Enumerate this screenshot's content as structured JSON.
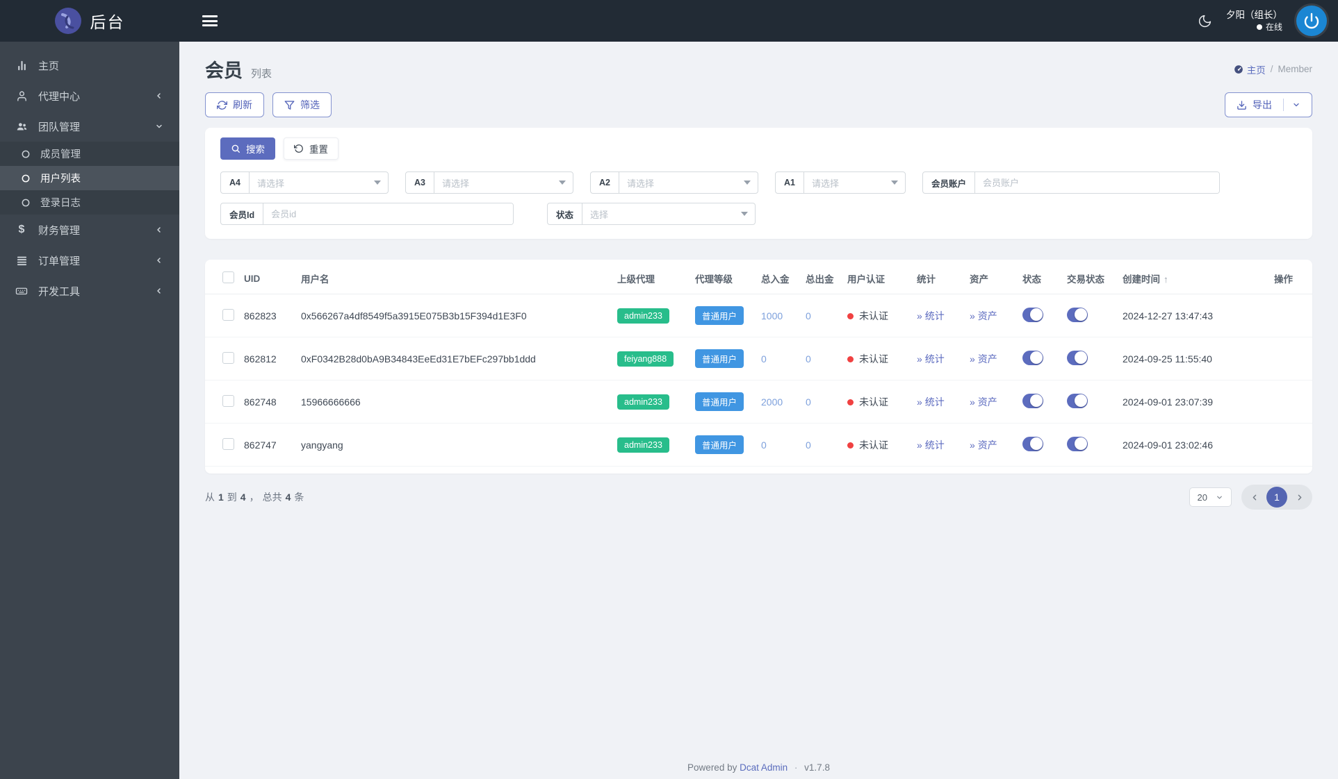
{
  "colors": {
    "primary": "#5c6cbe",
    "navbar_bg": "#222b35",
    "sidebar_bg": "#3c444d",
    "page_bg": "#f0f2f6",
    "badge_green": "#28bd8b",
    "badge_blue": "#4096e2",
    "danger_dot": "#f04141",
    "avatar_bg": "#1b86d3"
  },
  "navbar": {
    "logo_text": "后台",
    "user_name": "夕阳（组长）",
    "user_status": "在线"
  },
  "sidebar": {
    "items": [
      {
        "label": "主页",
        "icon": "bar-chart-icon"
      },
      {
        "label": "代理中心",
        "icon": "user-icon"
      },
      {
        "label": "团队管理",
        "icon": "users-icon",
        "children": [
          {
            "label": "成员管理"
          },
          {
            "label": "用户列表",
            "active": true
          },
          {
            "label": "登录日志"
          }
        ]
      },
      {
        "label": "财务管理",
        "icon": "dollar-icon"
      },
      {
        "label": "订单管理",
        "icon": "list-icon"
      },
      {
        "label": "开发工具",
        "icon": "keyboard-icon"
      }
    ]
  },
  "page_header": {
    "title": "会员",
    "subtitle": "列表",
    "breadcrumb_home": "主页",
    "breadcrumb_sep": "/",
    "breadcrumb_current": "Member"
  },
  "toolbar": {
    "refresh_label": "刷新",
    "filter_label": "筛选",
    "export_label": "导出"
  },
  "filters": {
    "search_label": "搜索",
    "reset_label": "重置",
    "fields": [
      {
        "label": "A4",
        "placeholder": "请选择",
        "type": "select"
      },
      {
        "label": "A3",
        "placeholder": "请选择",
        "type": "select"
      },
      {
        "label": "A2",
        "placeholder": "请选择",
        "type": "select"
      },
      {
        "label": "A1",
        "placeholder": "请选择",
        "type": "select"
      },
      {
        "label": "会员账户",
        "placeholder": "会员账户",
        "type": "input"
      },
      {
        "label": "会员Id",
        "placeholder": "会员id",
        "type": "input"
      },
      {
        "label": "状态",
        "placeholder": "选择",
        "type": "select"
      }
    ]
  },
  "table": {
    "columns": [
      "UID",
      "用户名",
      "上级代理",
      "代理等级",
      "总入金",
      "总出金",
      "用户认证",
      "统计",
      "资产",
      "状态",
      "交易状态",
      "创建时间",
      "操作"
    ],
    "sort_indicator": "↑",
    "link_prefix": "»",
    "stats_label": "统计",
    "assets_label": "资产",
    "rows": [
      {
        "uid": "862823",
        "username": "0x566267a4df8549f5a3915E075B3b15F394d1E3F0",
        "agent": "admin233",
        "level": "普通用户",
        "total_in": "1000",
        "total_out": "0",
        "auth": "未认证",
        "created": "2024-12-27 13:47:43"
      },
      {
        "uid": "862812",
        "username": "0xF0342B28d0bA9B34843EeEd31E7bEFc297bb1ddd",
        "agent": "feiyang888",
        "level": "普通用户",
        "total_in": "0",
        "total_out": "0",
        "auth": "未认证",
        "created": "2024-09-25 11:55:40"
      },
      {
        "uid": "862748",
        "username": "15966666666",
        "agent": "admin233",
        "level": "普通用户",
        "total_in": "2000",
        "total_out": "0",
        "auth": "未认证",
        "created": "2024-09-01 23:07:39"
      },
      {
        "uid": "862747",
        "username": "yangyang",
        "agent": "admin233",
        "level": "普通用户",
        "total_in": "0",
        "total_out": "0",
        "auth": "未认证",
        "created": "2024-09-01 23:02:46"
      }
    ]
  },
  "pagination": {
    "word_from": "从",
    "start": "1",
    "word_to": "到",
    "end": "4",
    "comma": "，",
    "word_total": "总共",
    "total": "4",
    "word_unit": "条",
    "page_size": "20",
    "current_page": "1"
  },
  "footer": {
    "powered_by": "Powered by",
    "brand": "Dcat Admin",
    "dot": "·",
    "version": "v1.7.8"
  }
}
